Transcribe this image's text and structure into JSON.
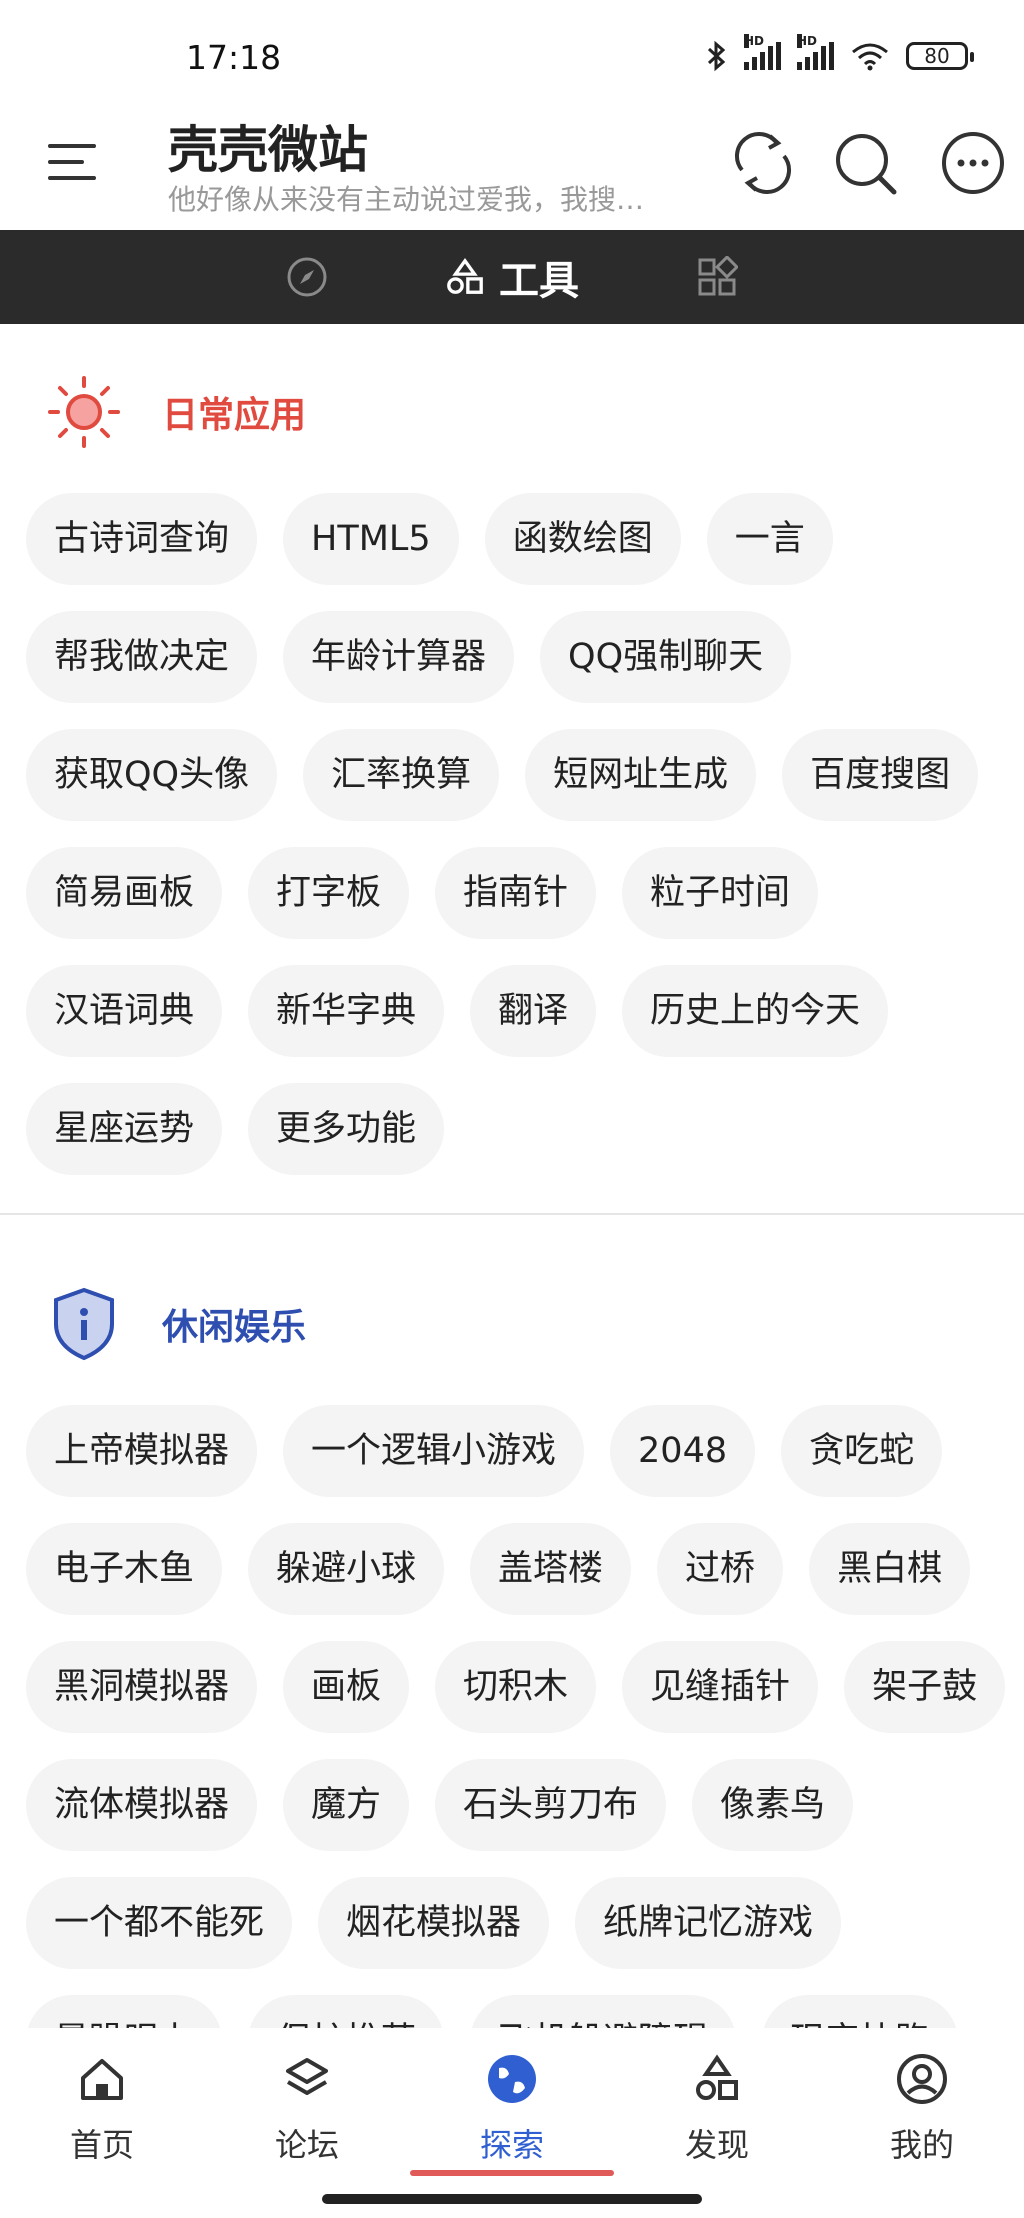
{
  "status": {
    "time": "17:18",
    "signal1": "HD",
    "signal2": "HD",
    "battery": "80"
  },
  "header": {
    "title": "壳壳微站",
    "subtitle": "他好像从来没有主动说过爱我，我搜…"
  },
  "tabs": {
    "active_label": "工具"
  },
  "daily": {
    "title": "日常应用",
    "color": "#e04a3f",
    "rows": [
      [
        "古诗词查询",
        "HTML5",
        "函数绘图",
        "一言"
      ],
      [
        "帮我做决定",
        "年龄计算器",
        "QQ强制聊天"
      ],
      [
        "获取QQ头像",
        "汇率换算",
        "短网址生成",
        "百度搜图"
      ],
      [
        "简易画板",
        "打字板",
        "指南针",
        "粒子时间"
      ],
      [
        "汉语词典",
        "新华字典",
        "翻译",
        "历史上的今天"
      ],
      [
        "星座运势",
        "更多功能"
      ]
    ]
  },
  "leisure": {
    "title": "休闲娱乐",
    "color": "#2f4fb0",
    "rows": [
      [
        "上帝模拟器",
        "一个逻辑小游戏",
        "2048",
        "贪吃蛇"
      ],
      [
        "电子木鱼",
        "躲避小球",
        "盖塔楼",
        "过桥",
        "黑白棋"
      ],
      [
        "黑洞模拟器",
        "画板",
        "切积木",
        "见缝插针",
        "架子鼓"
      ],
      [
        "流体模拟器",
        "魔方",
        "石头剪刀布",
        "像素鸟"
      ],
      [
        "一个都不能死",
        "烟花模拟器",
        "纸牌记忆游戏"
      ],
      [
        "暴躁眼力",
        "保护推荐",
        "飞机躲避障碍",
        "现实快跑"
      ]
    ]
  },
  "nav": [
    {
      "label": "首页",
      "icon": "home-icon"
    },
    {
      "label": "论坛",
      "icon": "layers-icon"
    },
    {
      "label": "探索",
      "icon": "globe-icon",
      "active": true
    },
    {
      "label": "发现",
      "icon": "shapes-icon"
    },
    {
      "label": "我的",
      "icon": "user-icon"
    }
  ]
}
